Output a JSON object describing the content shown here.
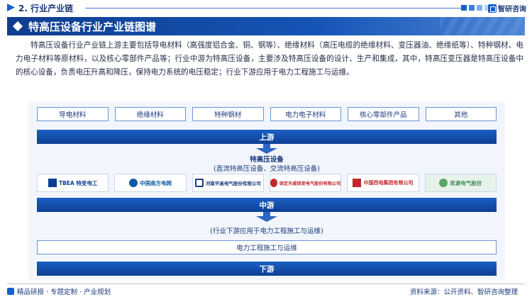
{
  "header": {
    "section_title": "2. 行业产业链",
    "brand_name": "智研咨询",
    "dot_colors": [
      "#1560c9",
      "#3b7fe0",
      "#7faeea",
      "#b8d2f5"
    ]
  },
  "title_bar": {
    "title": "特高压设备行业产业链图谱"
  },
  "intro": {
    "text": "特高压设备行业产业链上游主要包括导电材料（高强度铝合金、铜、钢等）、绝缘材料（高压电缆的绝缘材料、变压器油、绝缘纸等）、特种钢材、电力电子材料等原材料，以及核心零部件产品等；行业中游为特高压设备，主要涉及特高压设备的设计、生产和集成，其中，特高压变压器是特高压设备中的核心设备，负责电压升高和降压，保持电力系统的电压稳定；行业下游应用于电力工程施工与运维。"
  },
  "diagram": {
    "upstream_items": [
      "导电材料",
      "绝缘材料",
      "特种钢材",
      "电力电子材料",
      "核心零部件产品",
      "其他"
    ],
    "upstream_label": "上游",
    "midstream_title": "特高压设备",
    "midstream_subtitle": "(直流特高压设备、交流特高压设备)",
    "companies": [
      {
        "name": "TBEA 特变电工",
        "icon": "tbea-logo-icon",
        "color": "#0b3f8f"
      },
      {
        "name": "中国南方电网",
        "icon": "csg-logo-icon",
        "color": "#0b5aa8"
      },
      {
        "name": "河南平高电气股份有限公司",
        "icon": "pinggao-logo-icon",
        "color": "#1a3a7a"
      },
      {
        "name": "保定天威保变电气股份有限公司",
        "icon": "baobian-logo-icon",
        "color": "#c0282d"
      },
      {
        "name": "中国西电集团有限公司",
        "icon": "xd-logo-icon",
        "color": "#c0282d"
      },
      {
        "name": "思源电气股份",
        "icon": "sieyuan-logo-icon",
        "color": "#5aa36a"
      }
    ],
    "midstream_label": "中游",
    "downstream_title": "(行业下游应用于电力工程施工与运维)",
    "downstream_item": "电力工程施工与运维",
    "downstream_label": "下游"
  },
  "footer": {
    "left_text": "精品研报 · 专题定制 · 产业规划",
    "source_text": "资料来源：公开资料、智研咨询整理"
  }
}
